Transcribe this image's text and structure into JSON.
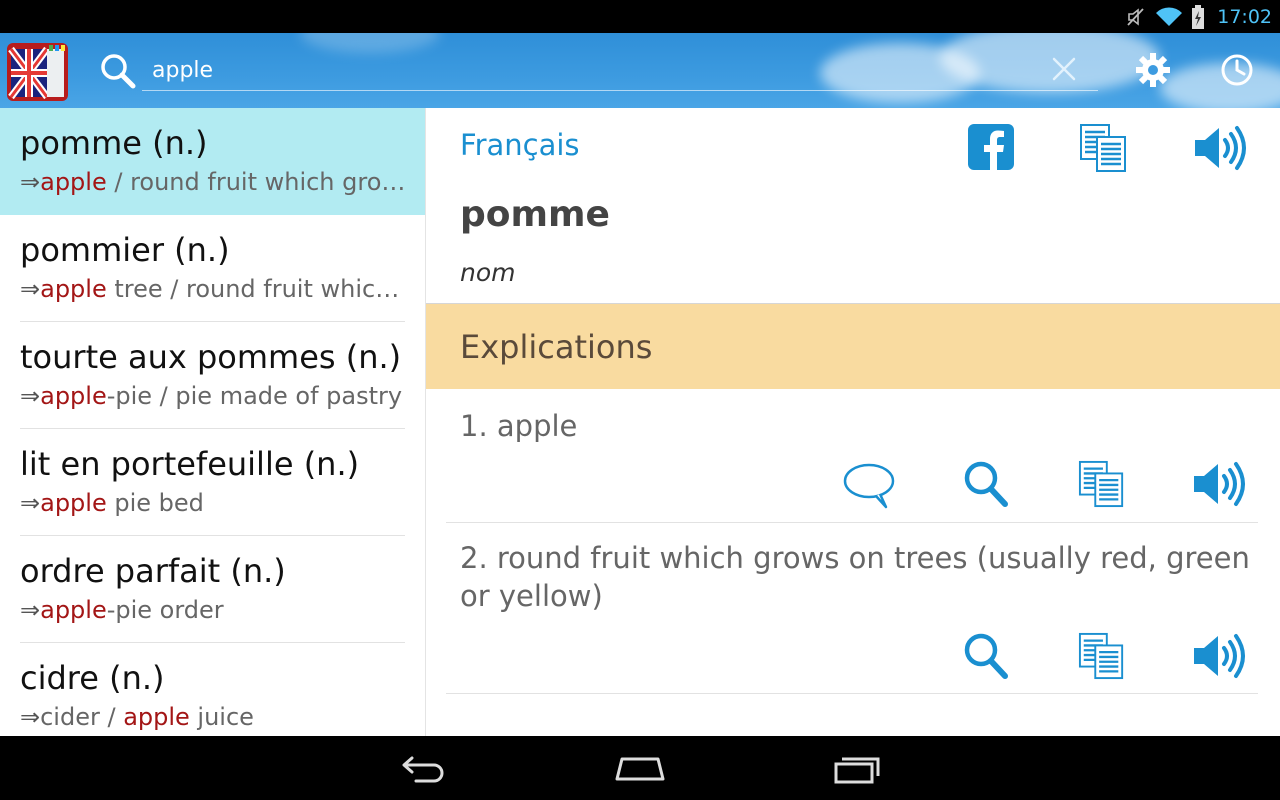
{
  "status_bar": {
    "time": "17:02"
  },
  "search": {
    "value": "apple"
  },
  "results": [
    {
      "term": "pomme (n.)",
      "gloss": [
        {
          "t": "apple",
          "hl": true
        },
        {
          "t": " / round fruit which grows on trees",
          "hl": false
        }
      ]
    },
    {
      "term": "pommier (n.)",
      "gloss": [
        {
          "t": "apple",
          "hl": true
        },
        {
          "t": " tree / round fruit which grows on trees",
          "hl": false
        }
      ]
    },
    {
      "term": "tourte aux pommes (n.)",
      "gloss": [
        {
          "t": "apple",
          "hl": true
        },
        {
          "t": "-pie / pie made of pastry",
          "hl": false
        }
      ]
    },
    {
      "term": "lit en portefeuille (n.)",
      "gloss": [
        {
          "t": "apple",
          "hl": true
        },
        {
          "t": " pie bed",
          "hl": false
        }
      ]
    },
    {
      "term": "ordre parfait (n.)",
      "gloss": [
        {
          "t": "apple",
          "hl": true
        },
        {
          "t": "-pie order",
          "hl": false
        }
      ]
    },
    {
      "term": "cidre (n.)",
      "gloss": [
        {
          "t": "cider / ",
          "hl": false
        },
        {
          "t": "apple",
          "hl": true
        },
        {
          "t": " juice",
          "hl": false
        }
      ]
    }
  ],
  "detail": {
    "language": "Français",
    "headword": "pomme",
    "part_of_speech": "nom",
    "section_title": "Explications",
    "meanings": [
      {
        "text": "1. apple"
      },
      {
        "text": "2. round fruit which grows on trees (usually red, green or yellow)"
      }
    ]
  },
  "colors": {
    "accent": "#1a8fd0",
    "highlight": "#a31616",
    "selected_row": "#b2ebf2",
    "section_header": "#f9dba0"
  },
  "icons": {
    "app_bar": [
      "app-logo-icon",
      "search-icon",
      "clear-icon",
      "settings-icon",
      "history-icon"
    ],
    "detail_header": [
      "facebook-icon",
      "copy-icon",
      "speaker-icon"
    ],
    "meaning_actions": [
      "comment-icon",
      "search-icon",
      "copy-icon",
      "speaker-icon"
    ],
    "nav": [
      "back-icon",
      "home-icon",
      "recent-apps-icon"
    ]
  }
}
